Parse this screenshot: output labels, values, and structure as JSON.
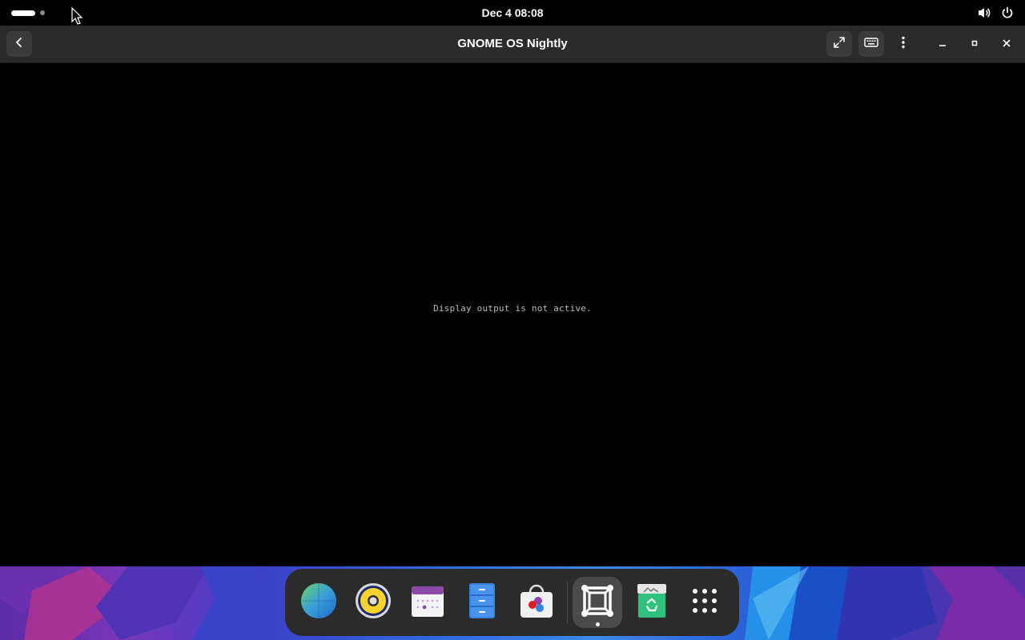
{
  "topbar": {
    "clock": "Dec 4  08:08",
    "icons": [
      "workspace-indicator",
      "volume-icon",
      "power-icon"
    ]
  },
  "window": {
    "title": "GNOME OS Nightly",
    "header_buttons": [
      "back-icon",
      "fullscreen-icon",
      "keyboard-icon",
      "menu-icon",
      "minimize-icon",
      "maximize-icon",
      "close-icon"
    ]
  },
  "content": {
    "message": "Display output is not active."
  },
  "dock": {
    "apps": [
      "web-browser-icon",
      "rhythmbox-icon",
      "calendar-icon",
      "files-icon",
      "software-icon",
      "boxes-icon",
      "trash-icon",
      "app-grid-icon"
    ],
    "active": "boxes-icon"
  }
}
